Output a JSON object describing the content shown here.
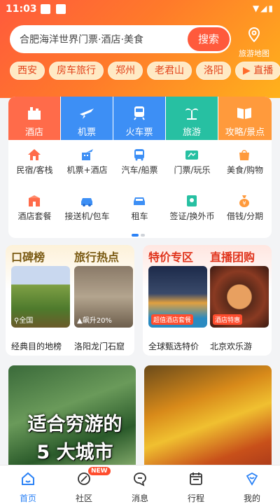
{
  "status": {
    "time": "11:03"
  },
  "search": {
    "placeholder": "合肥海洋世界门票·酒店·美食",
    "button": "搜索"
  },
  "map": {
    "label": "旅游地图"
  },
  "chips": [
    "西安",
    "房车旅行",
    "郑州",
    "老君山",
    "洛阳",
    "直播"
  ],
  "grid": {
    "top": [
      {
        "label": "酒店",
        "color": "#ff6b4a",
        "icon": "hotel-icon"
      },
      {
        "label": "机票",
        "color": "#3d8ff5",
        "icon": "plane-icon"
      },
      {
        "label": "火车票",
        "color": "#3d8ff5",
        "icon": "train-icon"
      },
      {
        "label": "旅游",
        "color": "#27c0a2",
        "icon": "palm-tree-icon"
      },
      {
        "label": "攻略/景点",
        "color": "#ff9a3c",
        "icon": "guide-book-icon"
      }
    ],
    "row2": [
      {
        "label": "民宿/客栈",
        "icon": "house-icon"
      },
      {
        "label": "机票+酒店",
        "icon": "plane-hotel-icon"
      },
      {
        "label": "汽车/船票",
        "icon": "bus-icon"
      },
      {
        "label": "门票/玩乐",
        "icon": "ticket-icon"
      },
      {
        "label": "美食/购物",
        "icon": "shopping-bag-icon"
      }
    ],
    "row3": [
      {
        "label": "酒店套餐",
        "icon": "hotel-package-icon"
      },
      {
        "label": "接送机/包车",
        "icon": "car-icon"
      },
      {
        "label": "租车",
        "icon": "rental-car-icon"
      },
      {
        "label": "签证/换外币",
        "icon": "visa-icon"
      },
      {
        "label": "借钱/分期",
        "icon": "money-bag-icon"
      }
    ]
  },
  "features": {
    "left": {
      "h1": "口碑榜",
      "h2": "旅行热点",
      "img1_tag": "全国",
      "img2_tag": "飙升20%",
      "cap1": "经典目的地榜",
      "cap2": "洛阳龙门石窟"
    },
    "right": {
      "h1": "特价专区",
      "h2": "直播团购",
      "img1_tag": "超值酒店套餐",
      "img2_tag": "酒店特惠",
      "cap1": "全球甄选特价",
      "cap2": "北京欢乐游"
    }
  },
  "banner": {
    "line1": "适合穷游的",
    "line2": "5 大城市"
  },
  "tabs": [
    {
      "label": "首页",
      "icon": "home-icon",
      "active": true
    },
    {
      "label": "社区",
      "icon": "community-icon",
      "badge": "NEW"
    },
    {
      "label": "消息",
      "icon": "message-icon"
    },
    {
      "label": "行程",
      "icon": "itinerary-icon"
    },
    {
      "label": "我的",
      "icon": "profile-icon"
    }
  ],
  "colors": {
    "brand": "#ff5a3c",
    "accent": "#ff8a1e",
    "active_tab": "#2b82f6"
  }
}
